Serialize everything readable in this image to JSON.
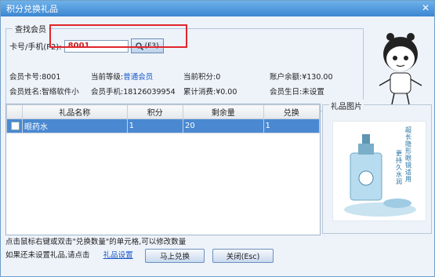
{
  "window": {
    "title": "积分兑换礼品",
    "close_glyph": "✕"
  },
  "search": {
    "group_title": "查找会员",
    "label": "卡号/手机(F2):",
    "value": "8001",
    "button_label": "(F3)",
    "button_icon": "magnifier-icon"
  },
  "member": {
    "card_label": "会员卡号:",
    "card_value": "8001",
    "level_label": "当前等级:",
    "level_value": "普通会员",
    "points_label": "当前积分:",
    "points_value": "0",
    "balance_label": "账户余额:",
    "balance_value": "¥130.00",
    "name_label": "会员姓名:",
    "name_value": "智络软件小",
    "phone_label": "会员手机:",
    "phone_value": "18126039954",
    "spend_label": "累计消费:",
    "spend_value": "¥0.00",
    "birthday_label": "会员生日:",
    "birthday_value": "未设置"
  },
  "table": {
    "headers": [
      "礼品名称",
      "积分",
      "剩余量",
      "兑换"
    ],
    "rows": [
      {
        "name": "眼药水",
        "points": "1",
        "remaining": "20",
        "exchange": "1",
        "checked": false
      }
    ]
  },
  "gift_image": {
    "title": "礼品图片",
    "product_text": [
      "超",
      "长",
      "隐",
      "形",
      "眼",
      "镜",
      "适",
      "用"
    ],
    "product_text2": [
      "更",
      "持",
      "久",
      "水",
      "润"
    ]
  },
  "notes": {
    "hint": "点击鼠标右键或双击\"兑换数量\"的单元格,可以修改数量",
    "setup_text": "如果还未设置礼品,请点击",
    "setup_link": "礼品设置"
  },
  "buttons": {
    "exchange": "马上兑换",
    "close": "关闭(Esc)"
  },
  "colors": {
    "accent": "#3b86d1",
    "highlight": "#e0262c",
    "selected_row": "#4a89d2"
  }
}
